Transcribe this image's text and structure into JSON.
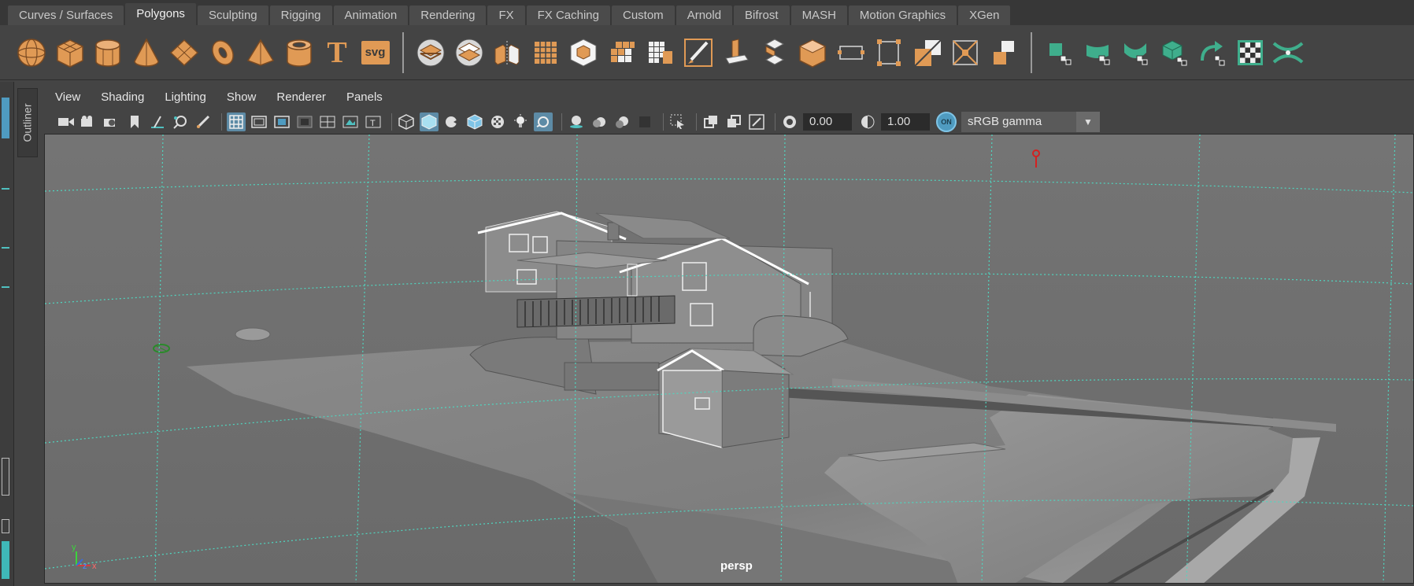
{
  "shelf": {
    "tabs": [
      "Curves / Surfaces",
      "Polygons",
      "Sculpting",
      "Rigging",
      "Animation",
      "Rendering",
      "FX",
      "FX Caching",
      "Custom",
      "Arnold",
      "Bifrost",
      "MASH",
      "Motion Graphics",
      "XGen"
    ],
    "active_tab": "Polygons",
    "text_tool_label": "T",
    "svg_tool_label": "svg"
  },
  "outliner": {
    "label": "Outliner"
  },
  "panel": {
    "menu": [
      "View",
      "Shading",
      "Lighting",
      "Show",
      "Renderer",
      "Panels"
    ],
    "exposure_value": "0.00",
    "gamma_value": "1.00",
    "color_management_label": "ON",
    "color_space": "sRGB gamma"
  },
  "viewport": {
    "camera_name": "persp",
    "axis_labels": {
      "x": "x",
      "y": "y",
      "z": "z"
    }
  },
  "colors": {
    "shelf_icon": "#e09a55",
    "accent_blue": "#5d8ba6",
    "grid_line": "#4fd6c0",
    "modeling_toolkit_green": "#3fae8c"
  }
}
